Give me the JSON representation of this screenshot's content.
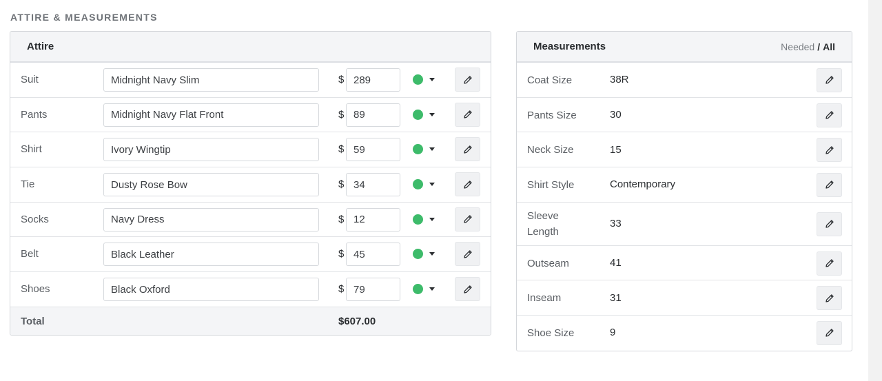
{
  "section": {
    "title": "ATTIRE & MEASUREMENTS"
  },
  "attire": {
    "header": "Attire",
    "currency": "$",
    "status_color": "#3dbb6a",
    "items": [
      {
        "label": "Suit",
        "name": "Midnight Navy Slim",
        "price": "289"
      },
      {
        "label": "Pants",
        "name": "Midnight Navy Flat Front",
        "price": "89"
      },
      {
        "label": "Shirt",
        "name": "Ivory Wingtip",
        "price": "59"
      },
      {
        "label": "Tie",
        "name": "Dusty Rose Bow",
        "price": "34"
      },
      {
        "label": "Socks",
        "name": "Navy Dress",
        "price": "12"
      },
      {
        "label": "Belt",
        "name": "Black Leather",
        "price": "45"
      },
      {
        "label": "Shoes",
        "name": "Black Oxford",
        "price": "79"
      }
    ],
    "total_label": "Total",
    "total_value": "$607.00"
  },
  "measurements": {
    "header": "Measurements",
    "filter_needed": "Needed",
    "filter_sep": "/",
    "filter_all": "All",
    "items": [
      {
        "label": "Coat Size",
        "value": "38R"
      },
      {
        "label": "Pants Size",
        "value": "30"
      },
      {
        "label": "Neck Size",
        "value": "15"
      },
      {
        "label": "Shirt Style",
        "value": "Contemporary"
      },
      {
        "label": "Sleeve Length",
        "value": "33"
      },
      {
        "label": "Outseam",
        "value": "41"
      },
      {
        "label": "Inseam",
        "value": "31"
      },
      {
        "label": "Shoe Size",
        "value": "9"
      }
    ]
  }
}
